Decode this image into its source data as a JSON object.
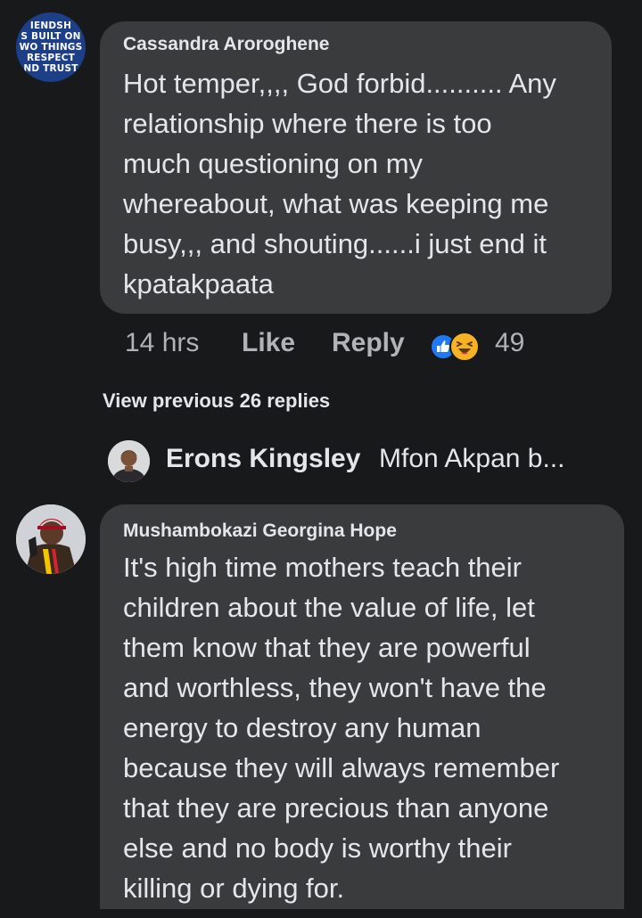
{
  "comment1": {
    "avatar_text": [
      "IENDSH",
      "S BUILT ON",
      "WO THINGS",
      "RESPECT",
      "ND TRUST"
    ],
    "author": "Cassandra Aroroghene",
    "lines": [
      "Hot temper,,,, God forbid.......... Any",
      "relationship where there is too",
      "much questioning on my",
      "whereabout, what was keeping me",
      "busy,,, and shouting......i just end it",
      "kpatakpaata"
    ],
    "time": "14 hrs",
    "like_label": "Like",
    "reply_label": "Reply",
    "reaction_icons": [
      "like-icon",
      "haha-icon"
    ],
    "reaction_count": "49"
  },
  "view_previous_label": "View previous 26 replies",
  "reply_preview": {
    "author": "Erons Kingsley",
    "preview": "Mfon Akpan b..."
  },
  "comment2": {
    "author": "Mushambokazi Georgina Hope",
    "lines": [
      "It's high time mothers teach their",
      "children about the value of life, let",
      "them know that they are powerful",
      "and worthless, they won't have the",
      "energy to destroy any human",
      "because they will always remember",
      "that they are precious than anyone",
      "else and no body is worthy their",
      "killing or dying for."
    ]
  },
  "colors": {
    "background": "#18191a",
    "bubble": "#3a3b3c",
    "text": "#e4e6eb",
    "muted": "#b0b3b8",
    "like_blue": "#2078f4",
    "haha_yellow": "#f7b125"
  }
}
